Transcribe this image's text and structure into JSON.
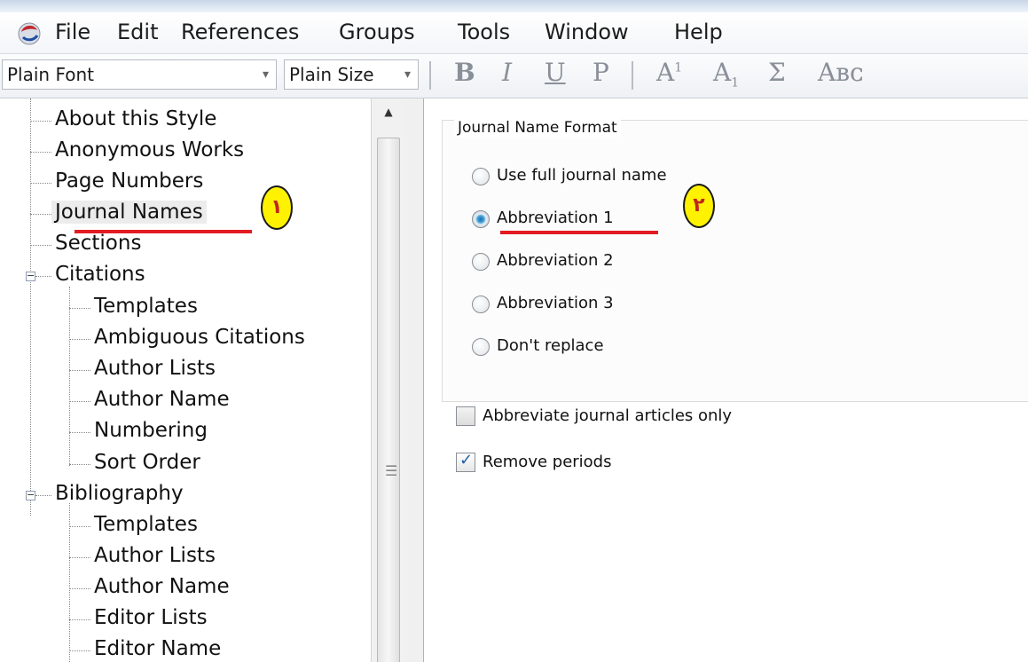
{
  "menubar": {
    "items": [
      "File",
      "Edit",
      "References",
      "Groups",
      "Tools",
      "Window",
      "Help"
    ]
  },
  "toolbar": {
    "font_combo": "Plain Font",
    "size_combo": "Plain Size",
    "format_buttons": {
      "bold": "B",
      "italic": "I",
      "underline": "U",
      "plain": "P",
      "superscript_base": "A",
      "superscript_mark": "1",
      "subscript_base": "A",
      "subscript_mark": "1",
      "symbol": "Σ",
      "small_caps": "Aʙᴄ"
    }
  },
  "tree": {
    "items": [
      "About this Style",
      "Anonymous Works",
      "Page Numbers",
      "Journal Names",
      "Sections",
      "Citations",
      "Templates",
      "Ambiguous Citations",
      "Author Lists",
      "Author Name",
      "Numbering",
      "Sort Order",
      "Bibliography",
      "Templates",
      "Author Lists",
      "Author Name",
      "Editor Lists",
      "Editor Name"
    ],
    "selected_index": 3
  },
  "journal_format": {
    "group_title": "Journal Name Format",
    "options": [
      "Use full journal name",
      "Abbreviation 1",
      "Abbreviation 2",
      "Abbreviation 3",
      "Don't replace"
    ],
    "selected_index": 1
  },
  "checkboxes": {
    "abbreviate_only": {
      "label": "Abbreviate journal articles only",
      "checked": false
    },
    "remove_periods": {
      "label": "Remove periods",
      "checked": true
    }
  },
  "annotations": {
    "badge_1": "١",
    "badge_2": "٢",
    "underline_color": "#e31b23",
    "badge_color": "#fff200"
  },
  "scrollbar": {
    "up_arrow": "▲",
    "grip": "☰"
  }
}
